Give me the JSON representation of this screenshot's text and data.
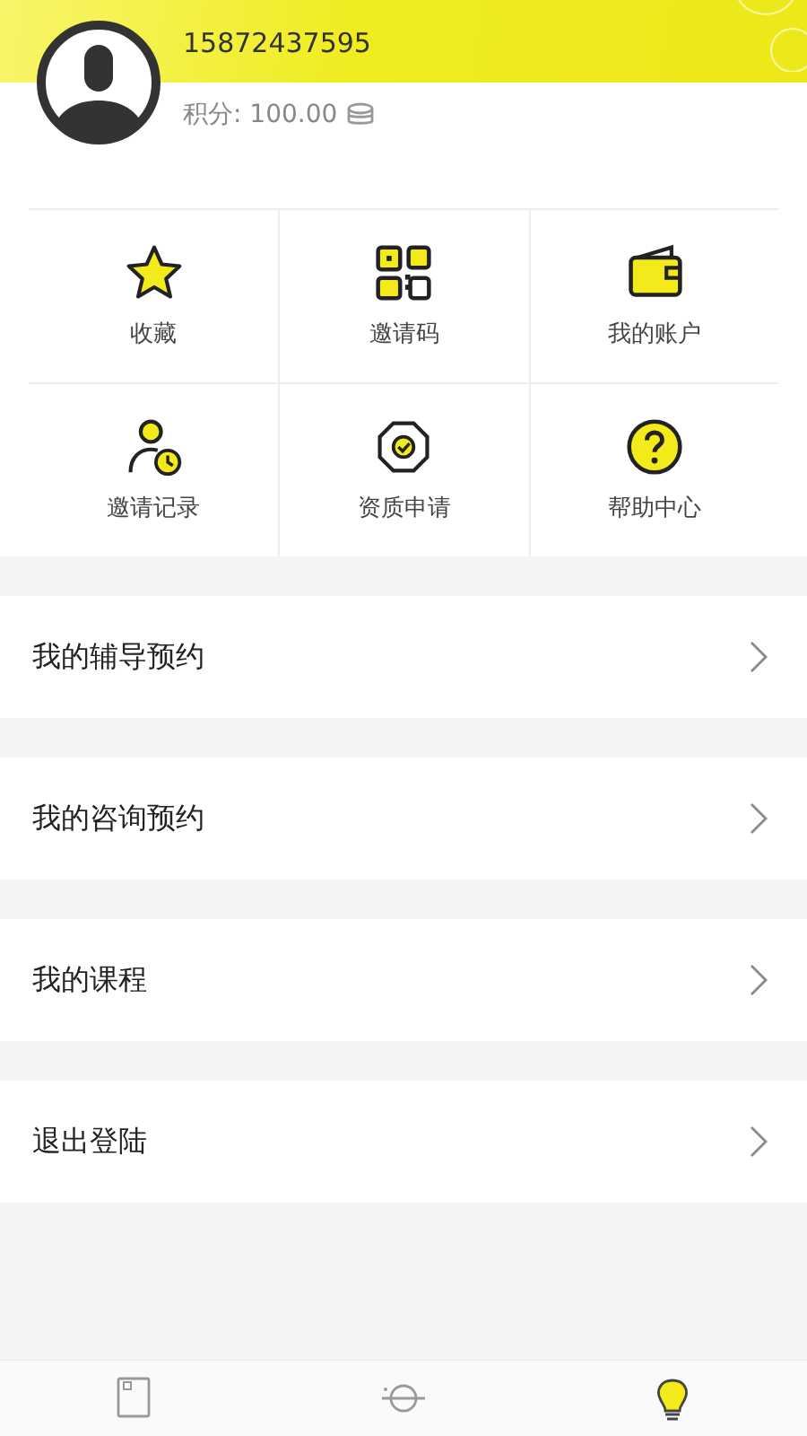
{
  "profile": {
    "phone": "15872437595",
    "points": "积分: 100.00"
  },
  "shortcuts": [
    {
      "kind": "star",
      "label": "收藏"
    },
    {
      "kind": "qr",
      "label": "邀请码"
    },
    {
      "kind": "wallet",
      "label": "我的账户"
    },
    {
      "kind": "invite",
      "label": "邀请记录"
    },
    {
      "kind": "badge",
      "label": "资质申请"
    },
    {
      "kind": "help",
      "label": "帮助中心"
    }
  ],
  "menu": [
    {
      "label": "我的辅导预约"
    },
    {
      "label": "我的咨询预约"
    },
    {
      "label": "我的课程"
    },
    {
      "label": "退出登陆"
    }
  ],
  "tabs": [
    {
      "kind": "book",
      "selected": false
    },
    {
      "kind": "planet",
      "selected": false
    },
    {
      "kind": "bulb",
      "selected": true
    }
  ]
}
